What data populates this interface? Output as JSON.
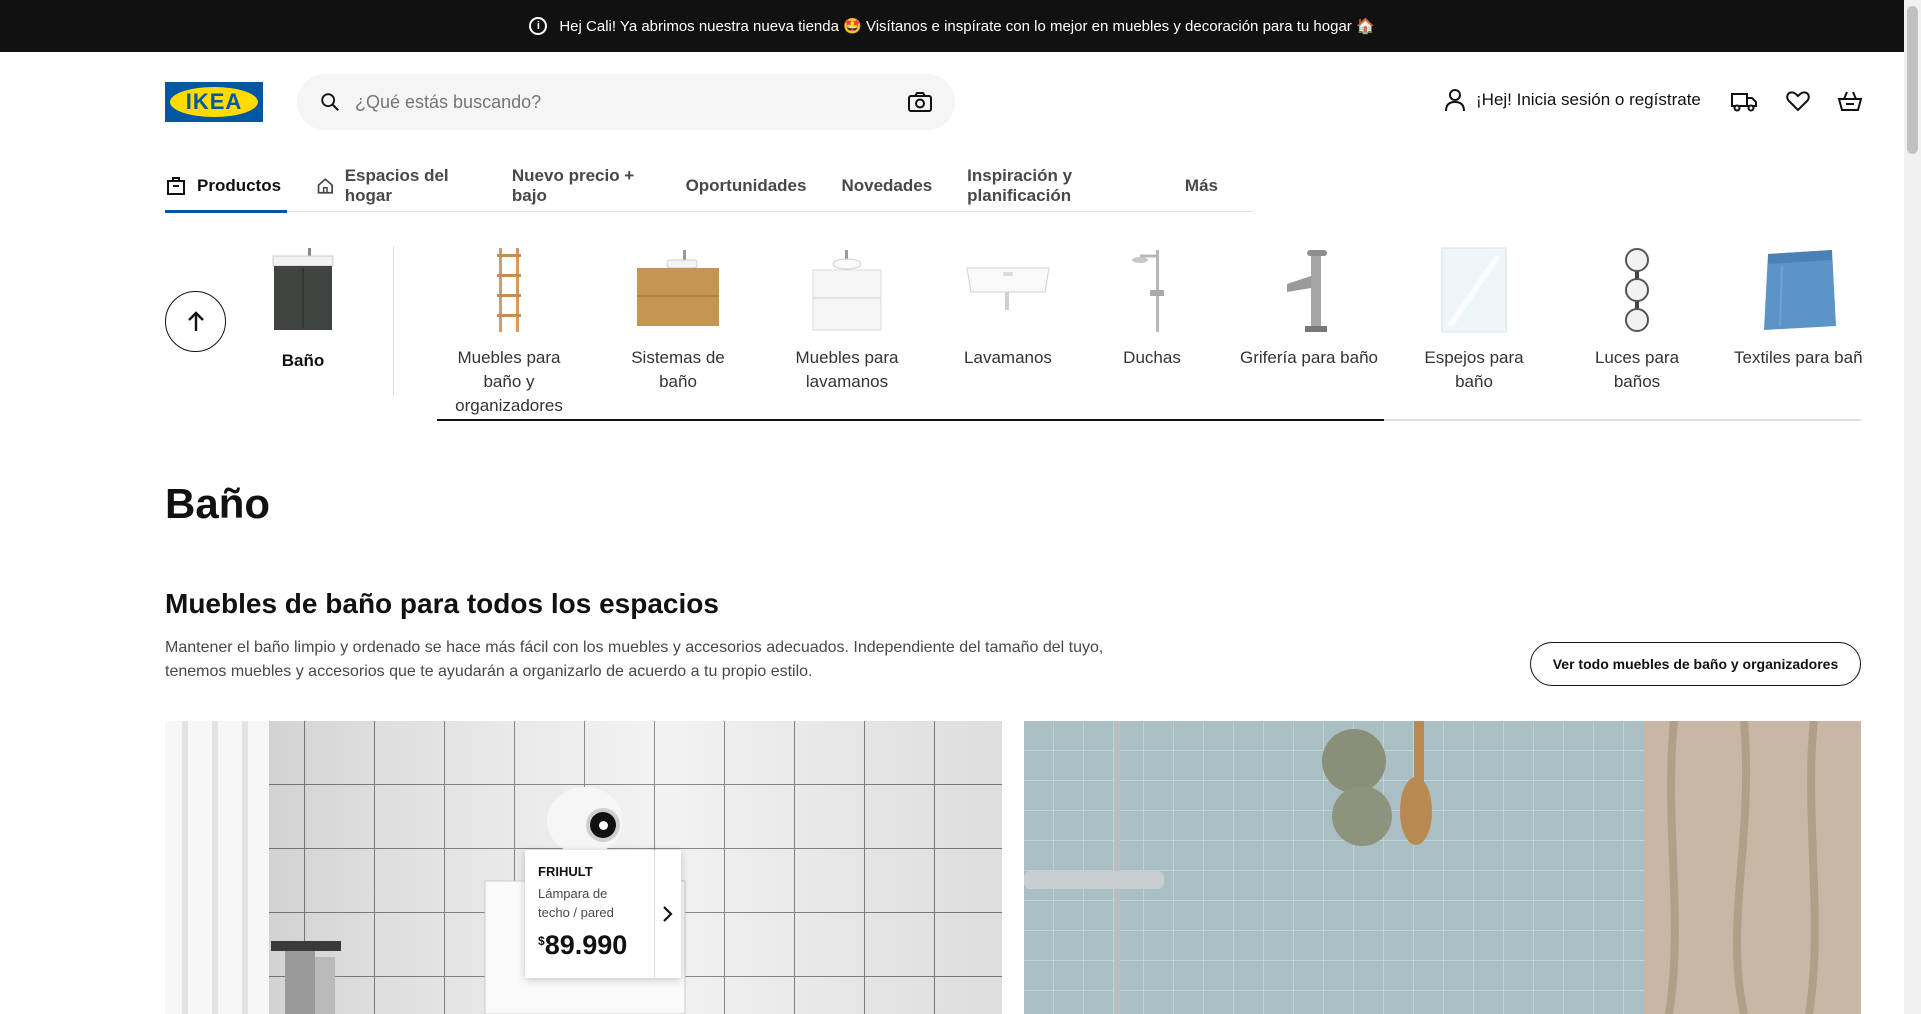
{
  "announcement": {
    "text": "Hej Cali! Ya abrimos nuestra nueva tienda 🤩 Visítanos e inspírate con lo mejor en muebles y decoración para tu hogar 🏠"
  },
  "header": {
    "logo_text": "IKEA",
    "search_placeholder": "¿Qué estás buscando?",
    "login_label": "¡Hej! Inicia sesión o regístrate"
  },
  "nav": {
    "tabs": [
      {
        "label": "Productos",
        "active": true
      },
      {
        "label": "Espacios del hogar"
      },
      {
        "label": "Nuevo precio + bajo"
      },
      {
        "label": "Oportunidades"
      },
      {
        "label": "Novedades"
      },
      {
        "label": "Inspiración y planificación"
      },
      {
        "label": "Más"
      }
    ]
  },
  "categories": {
    "current": "Baño",
    "items": [
      {
        "label": "Muebles para baño y organizadores"
      },
      {
        "label": "Sistemas de baño"
      },
      {
        "label": "Muebles para lavamanos"
      },
      {
        "label": "Lavamanos"
      },
      {
        "label": "Duchas"
      },
      {
        "label": "Grifería para baño"
      },
      {
        "label": "Espejos para baño"
      },
      {
        "label": "Luces para baños"
      },
      {
        "label": "Textiles para baño"
      }
    ],
    "scroll_progress": 0.665
  },
  "page": {
    "title": "Baño",
    "section_title": "Muebles de baño para todos los espacios",
    "section_description": "Mantener el baño limpio y ordenado se hace más fácil con los muebles y accesorios adecuados. Independiente del tamaño del tuyo, tenemos muebles y accesorios que te ayudarán a organizarlo de acuerdo a tu propio estilo.",
    "see_all_label": "Ver todo muebles de baño y organizadores"
  },
  "product_tooltip": {
    "name": "FRIHULT",
    "description": "Lámpara de techo / pared",
    "currency": "$",
    "price": "89.990"
  },
  "colors": {
    "brand_blue": "#0058a3",
    "brand_yellow": "#ffdb00",
    "topbar": "#111111"
  }
}
